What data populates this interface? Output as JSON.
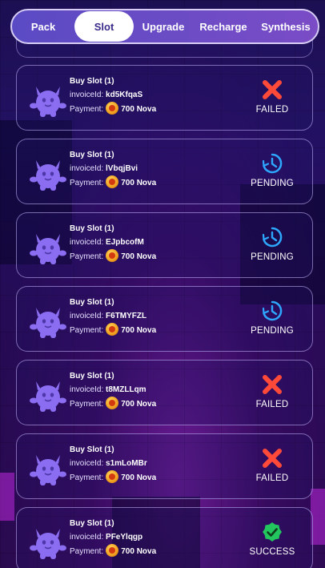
{
  "tabs": [
    {
      "label": "Pack",
      "active": false
    },
    {
      "label": "Slot",
      "active": true
    },
    {
      "label": "Upgrade",
      "active": false
    },
    {
      "label": "Recharge",
      "active": false
    },
    {
      "label": "Synthesis",
      "active": false
    }
  ],
  "labels": {
    "invoice": "invoiceId:",
    "payment": "Payment:"
  },
  "transactions": [
    {
      "title": "Buy Slot (1)",
      "invoice_id": "kd5KfqaS",
      "amount": "700 Nova",
      "status": "FAILED",
      "status_icon": "x-icon"
    },
    {
      "title": "Buy Slot (1)",
      "invoice_id": "lVbqjBvi",
      "amount": "700 Nova",
      "status": "PENDING",
      "status_icon": "clock-icon"
    },
    {
      "title": "Buy Slot (1)",
      "invoice_id": "EJpbcofM",
      "amount": "700 Nova",
      "status": "PENDING",
      "status_icon": "clock-icon"
    },
    {
      "title": "Buy Slot (1)",
      "invoice_id": "F6TMYFZL",
      "amount": "700 Nova",
      "status": "PENDING",
      "status_icon": "clock-icon"
    },
    {
      "title": "Buy Slot (1)",
      "invoice_id": "t8MZLLqm",
      "amount": "700 Nova",
      "status": "FAILED",
      "status_icon": "x-icon"
    },
    {
      "title": "Buy Slot (1)",
      "invoice_id": "s1mLoMBr",
      "amount": "700 Nova",
      "status": "FAILED",
      "status_icon": "x-icon"
    },
    {
      "title": "Buy Slot (1)",
      "invoice_id": "PFeYlqgp",
      "amount": "700 Nova",
      "status": "SUCCESS",
      "status_icon": "check-badge-icon"
    }
  ],
  "colors": {
    "failed": "#ff4a3a",
    "pending": "#2ea8ff",
    "success": "#22c55e",
    "avatar": "#8a6df0"
  }
}
